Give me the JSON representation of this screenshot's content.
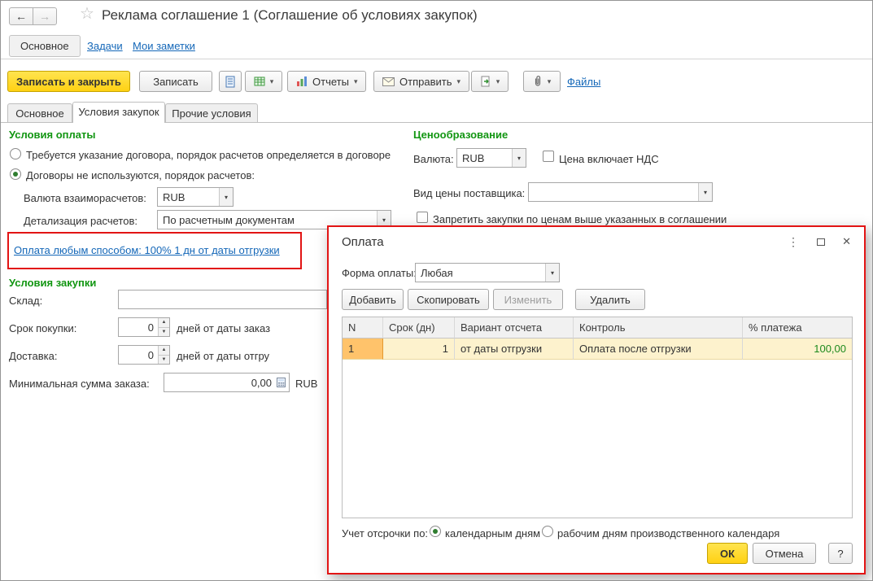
{
  "header": {
    "title": "Реклама соглашение 1 (Соглашение об условиях закупок)"
  },
  "icons": {
    "back": "←",
    "forward": "→",
    "star": "☆",
    "dropdown": "▾",
    "spin_up": "▲",
    "spin_down": "▼",
    "more": "⋮",
    "close": "✕"
  },
  "nav": {
    "main": "Основное",
    "tasks": "Задачи",
    "notes": "Мои заметки"
  },
  "toolbar": {
    "save_close": "Записать и закрыть",
    "save": "Записать",
    "reports": "Отчеты",
    "send": "Отправить",
    "files": "Файлы"
  },
  "tabs": {
    "main": "Основное",
    "purchase_terms": "Условия закупок",
    "other_terms": "Прочие условия"
  },
  "payment": {
    "header": "Условия оплаты",
    "radio_contract": "Требуется указание договора, порядок расчетов определяется в договоре",
    "radio_no_contract": "Договоры не используются, порядок расчетов:",
    "currency_label": "Валюта взаиморасчетов:",
    "currency_value": "RUB",
    "detail_label": "Детализация расчетов:",
    "detail_value": "По расчетным документам",
    "schedule_link": "Оплата любым способом: 100% 1 дн от даты отгрузки"
  },
  "purchase": {
    "header": "Условия закупки",
    "warehouse_label": "Склад:",
    "term_label": "Срок покупки:",
    "term_value": "0",
    "term_suffix": "дней от даты заказ",
    "delivery_label": "Доставка:",
    "delivery_value": "0",
    "delivery_suffix": "дней от даты отгру",
    "min_sum_label": "Минимальная сумма заказа:",
    "min_sum_value": "0,00",
    "min_sum_currency": "RUB"
  },
  "pricing": {
    "header": "Ценообразование",
    "currency_label": "Валюта:",
    "currency_value": "RUB",
    "vat_label": "Цена включает НДС",
    "price_type_label": "Вид цены поставщика:",
    "price_type_value": "",
    "restrict_label": "Запретить закупки по ценам выше указанных в соглашении"
  },
  "dialog": {
    "title": "Оплата",
    "form_label": "Форма оплаты:",
    "form_value": "Любая",
    "btn_add": "Добавить",
    "btn_copy": "Скопировать",
    "btn_edit": "Изменить",
    "btn_delete": "Удалить",
    "table": {
      "headers": [
        "N",
        "Срок (дн)",
        "Вариант отсчета",
        "Контроль",
        "% платежа"
      ],
      "row": {
        "n": "1",
        "term": "1",
        "variant": "от даты отгрузки",
        "control": "Оплата после отгрузки",
        "percent": "100,00"
      }
    },
    "deferral_label": "Учет отсрочки по:",
    "deferral_calendar": "календарным дням",
    "deferral_working": "рабочим дням производственного календаря",
    "btn_ok": "ОК",
    "btn_cancel": "Отмена",
    "btn_help": "?"
  },
  "colors": {
    "accent_yellow": "#ffd113",
    "green_header": "#129612",
    "link_blue": "#1467b8",
    "annotation_red": "#e21414",
    "row_selected": "#fdf2cd",
    "row_selector_orange": "#ffc36b",
    "percent_green": "#1e8a1e"
  }
}
